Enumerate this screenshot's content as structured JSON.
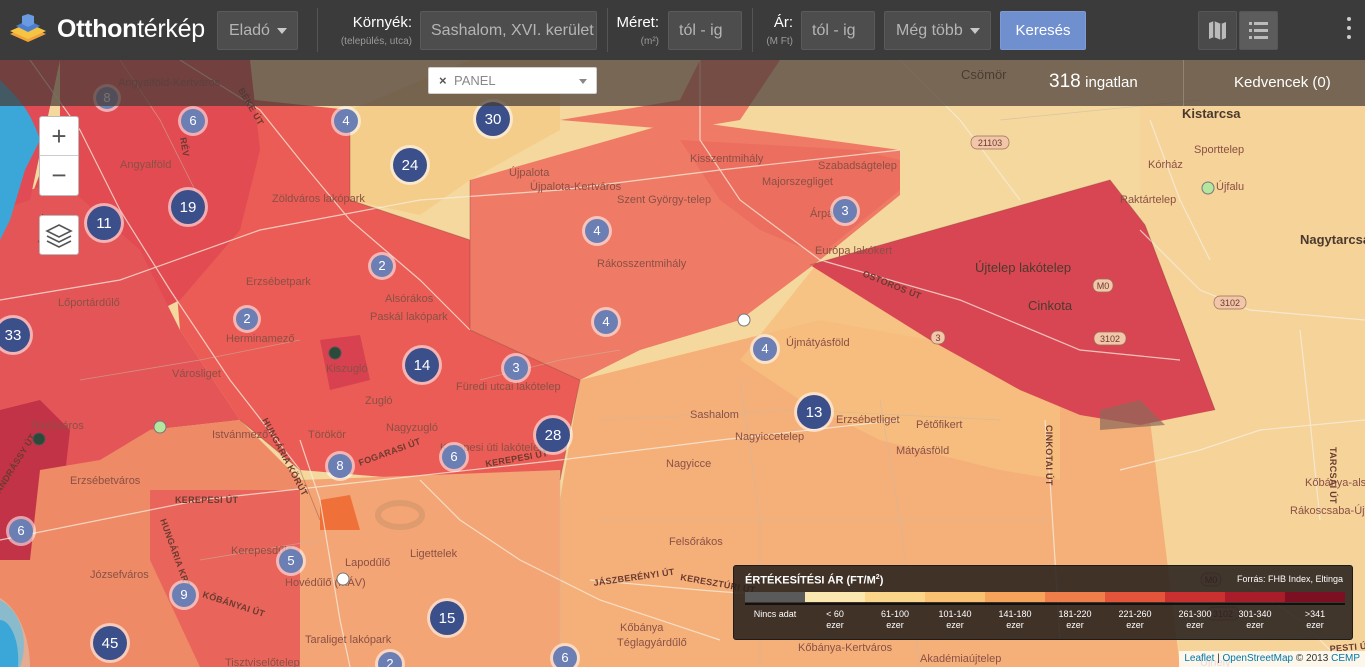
{
  "brand": {
    "bold": "Otthon",
    "rest": "térkép"
  },
  "topbar": {
    "listing_type": "Eladó",
    "location_label": "Környék:",
    "location_sub": "(település, utca)",
    "location_placeholder": "Sashalom, XVI. kerület",
    "size_label": "Méret:",
    "size_sub": "(m²)",
    "size_placeholder": "tól - ig",
    "price_label": "Ár:",
    "price_sub": "(M Ft)",
    "price_placeholder": "tól - ig",
    "more_label": "Még több",
    "search_label": "Keresés"
  },
  "subbar": {
    "filter_tag": "PANEL",
    "count_number": "318",
    "count_unit": "ingatlan",
    "favorites": "Kedvencek (0)"
  },
  "map": {
    "colors": {
      "dark_red": "#c8303e",
      "red": "#e6514a",
      "salmon": "#f07a5e",
      "orange": "#f5a06a",
      "light_orange": "#f8c07e",
      "pale": "#f5d89e",
      "water": "#3aa7d8",
      "cluster": "#3b4f8a",
      "cluster_small": "#6b7fb4"
    },
    "places": [
      {
        "name": "Angyalföld-Kertváros"
      },
      {
        "name": "Angyalföld"
      },
      {
        "name": "Zöldváros lakópark"
      },
      {
        "name": "Újpalota"
      },
      {
        "name": "Újpalota-Kertváros"
      },
      {
        "name": "Kisszentmihály"
      },
      {
        "name": "Szabadságtelep"
      },
      {
        "name": "Majorszegliget"
      },
      {
        "name": "Szent György-telep"
      },
      {
        "name": "Árpádföld"
      },
      {
        "name": "Európa lakókert"
      },
      {
        "name": "Rákosszentmihály"
      },
      {
        "name": "Erzsébetpark"
      },
      {
        "name": "Alsórákos"
      },
      {
        "name": "Paskál lakópark"
      },
      {
        "name": "Lőportárdűlő"
      },
      {
        "name": "Herminamező"
      },
      {
        "name": "Kiszugló"
      },
      {
        "name": "Városliget"
      },
      {
        "name": "Zugló"
      },
      {
        "name": "Füredi utcai lakótelep"
      },
      {
        "name": "Újmátyásföld"
      },
      {
        "name": "Sashalom"
      },
      {
        "name": "Nagyiccetelep"
      },
      {
        "name": "Erzsébetliget"
      },
      {
        "name": "Nagyicce"
      },
      {
        "name": "Pétőfikert"
      },
      {
        "name": "Mátyásföld"
      },
      {
        "name": "Újtelep lakótelep"
      },
      {
        "name": "Cinkota"
      },
      {
        "name": "Csömör"
      },
      {
        "name": "Kistarcsa"
      },
      {
        "name": "Nagytarcsa"
      },
      {
        "name": "Sporttelep"
      },
      {
        "name": "Kórház"
      },
      {
        "name": "Újfalu"
      },
      {
        "name": "Raktártelep"
      },
      {
        "name": "Terézváros"
      },
      {
        "name": "Istvánmező"
      },
      {
        "name": "Törökör"
      },
      {
        "name": "Nagyzugló"
      },
      {
        "name": "Kerepesi úti lakótelep"
      },
      {
        "name": "Erzsébetváros"
      },
      {
        "name": "Ligettelek"
      },
      {
        "name": "Felsőrákos"
      },
      {
        "name": "Kerepesdűlő"
      },
      {
        "name": "Lapodűlő"
      },
      {
        "name": "Józsefváros"
      },
      {
        "name": "Kőbánya"
      },
      {
        "name": "Téglagyárdűlő"
      },
      {
        "name": "Kőbánya-Kertváros"
      },
      {
        "name": "Taraliget lakópark"
      },
      {
        "name": "Akadémiaújtelep"
      },
      {
        "name": "Rákoscsaba-Újtelep"
      },
      {
        "name": "Hovédűlő (MÁV)"
      },
      {
        "name": "Tisztviselőtelep"
      },
      {
        "name": "Újhely"
      },
      {
        "name": "Kőbánya-alsó"
      },
      {
        "name": "Rákoskeresztúr"
      }
    ],
    "roads": [
      {
        "name": "OSTOROS ÚT"
      },
      {
        "name": "HUNGÁRIA KÖRÚT"
      },
      {
        "name": "FOGARASI ÚT"
      },
      {
        "name": "KEREPESI ÚT"
      },
      {
        "name": "KEREPESI ÚT"
      },
      {
        "name": "JÁSZBERÉNYI ÚT"
      },
      {
        "name": "KERESZTÚRI ÚT"
      },
      {
        "name": "PESTI ÚT"
      },
      {
        "name": "CINKOTAI ÚT"
      },
      {
        "name": "TARCSAI ÚT"
      },
      {
        "name": "ANDRÁSSY ÚT"
      },
      {
        "name": "KŐBÁNYAI ÚT"
      },
      {
        "name": "VÁCI ÚT"
      },
      {
        "name": "HUNGÁRIA KRT"
      },
      {
        "name": "RÉV"
      },
      {
        "name": "BÉKE ÚT"
      }
    ],
    "road_refs": [
      {
        "name": "M0"
      },
      {
        "name": "M0"
      },
      {
        "name": "3"
      },
      {
        "name": "3102"
      },
      {
        "name": "3102"
      },
      {
        "name": "3102"
      },
      {
        "name": "21103"
      }
    ],
    "clusters": [
      {
        "n": "8"
      },
      {
        "n": "6"
      },
      {
        "n": "4"
      },
      {
        "n": "30"
      },
      {
        "n": "24"
      },
      {
        "n": "19"
      },
      {
        "n": "11"
      },
      {
        "n": "4"
      },
      {
        "n": "3"
      },
      {
        "n": "2"
      },
      {
        "n": "2"
      },
      {
        "n": "4"
      },
      {
        "n": "33"
      },
      {
        "n": "14"
      },
      {
        "n": "3"
      },
      {
        "n": "4"
      },
      {
        "n": "13"
      },
      {
        "n": "28"
      },
      {
        "n": "6"
      },
      {
        "n": "8"
      },
      {
        "n": "6"
      },
      {
        "n": "5"
      },
      {
        "n": "9"
      },
      {
        "n": "15"
      },
      {
        "n": "45"
      },
      {
        "n": "2"
      },
      {
        "n": "6"
      }
    ]
  },
  "legend": {
    "title": "ÉRTÉKESÍTÉSI ÁR (FT/M",
    "title_sup": "2",
    "title_end": ")",
    "source": "Forrás: FHB Index, Eltinga",
    "bins": [
      {
        "l1": "Nincs adat",
        "l2": "",
        "color": "#5a5a5a"
      },
      {
        "l1": "< 60",
        "l2": "ezer",
        "color": "#fbe8b0"
      },
      {
        "l1": "61-100",
        "l2": "ezer",
        "color": "#fbd68a"
      },
      {
        "l1": "101-140",
        "l2": "ezer",
        "color": "#f9c172"
      },
      {
        "l1": "141-180",
        "l2": "ezer",
        "color": "#f6a45c"
      },
      {
        "l1": "181-220",
        "l2": "ezer",
        "color": "#f07e4a"
      },
      {
        "l1": "221-260",
        "l2": "ezer",
        "color": "#e3543b"
      },
      {
        "l1": "261-300",
        "l2": "ezer",
        "color": "#c9302f"
      },
      {
        "l1": "301-340",
        "l2": "ezer",
        "color": "#a91d2a"
      },
      {
        "l1": ">341",
        "l2": "ezer",
        "color": "#7d0f22"
      }
    ]
  },
  "attribution": {
    "leaflet": "Leaflet",
    "osm": "OpenStreetMap",
    "copy": "© 2013",
    "cemp": "CEMP"
  }
}
